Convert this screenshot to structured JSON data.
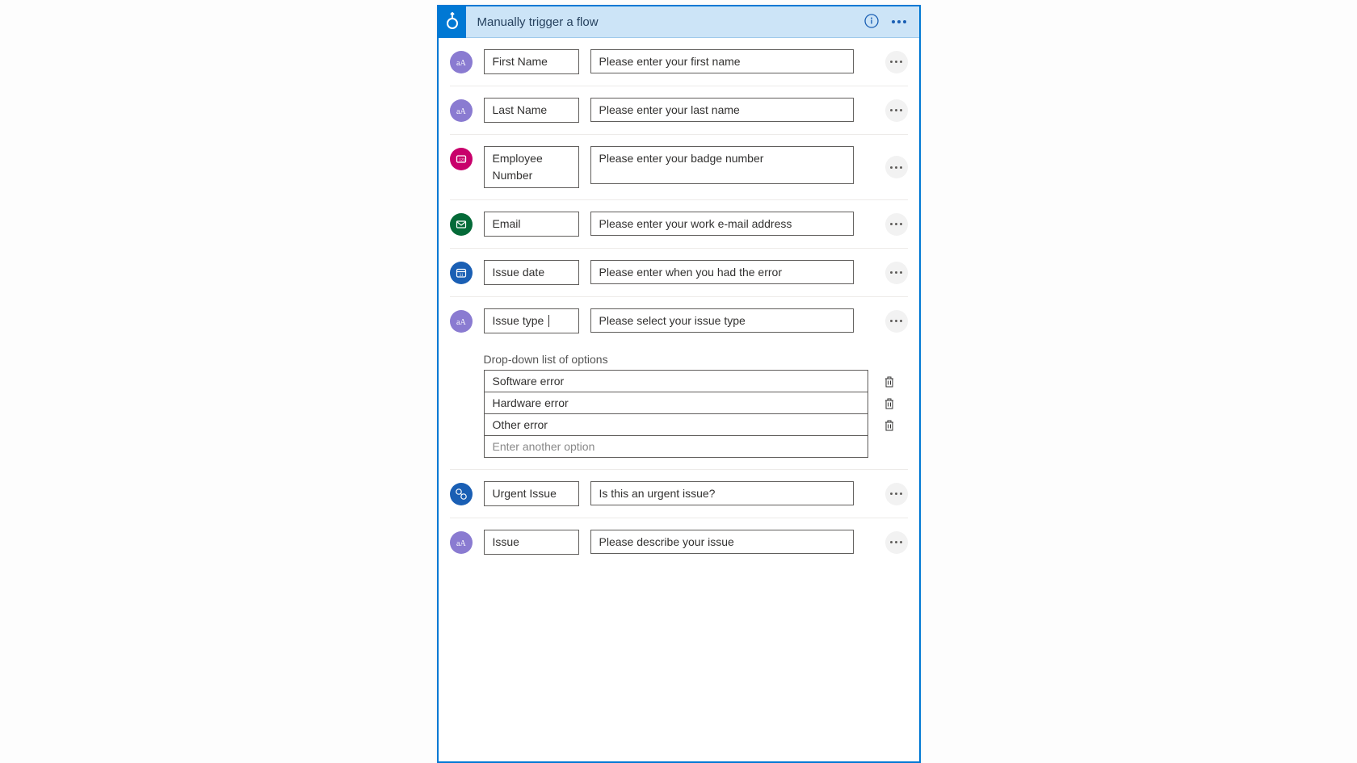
{
  "header": {
    "title": "Manually trigger a flow"
  },
  "rows": [
    {
      "label": "First Name",
      "value": "Please enter your first name",
      "icon": "text"
    },
    {
      "label": "Last Name",
      "value": "Please enter your last name",
      "icon": "text"
    },
    {
      "label": "Employee Number",
      "value": "Please enter your badge number",
      "icon": "number"
    },
    {
      "label": "Email",
      "value": "Please enter your work e-mail address",
      "icon": "email"
    },
    {
      "label": "Issue date",
      "value": "Please enter when you had the error",
      "icon": "date"
    },
    {
      "label": "Issue type",
      "value": "Please select your issue type",
      "icon": "text",
      "has_dropdown": true
    },
    {
      "label": "Urgent Issue",
      "value": "Is this an urgent issue?",
      "icon": "yesno"
    },
    {
      "label": "Issue",
      "value": "Please describe your issue",
      "icon": "text"
    }
  ],
  "dropdown": {
    "label": "Drop-down list of options",
    "options": [
      "Software error",
      "Hardware error",
      "Other error"
    ],
    "add_placeholder": "Enter another option"
  }
}
